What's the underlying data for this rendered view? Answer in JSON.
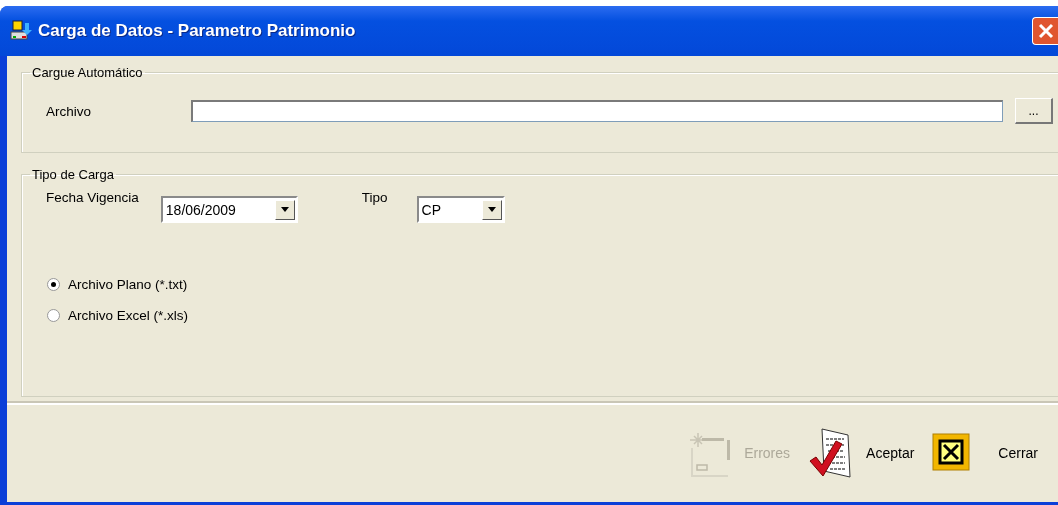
{
  "window": {
    "title": "Carga de Datos - Parametro Patrimonio"
  },
  "auto_load": {
    "legend": "Cargue Automático",
    "file_label": "Archivo",
    "browse_button": "..."
  },
  "load_type": {
    "legend": "Tipo de Carga",
    "date_label": "Fecha Vigencia",
    "date_value": "18/06/2009",
    "type_label": "Tipo",
    "type_value": "CP",
    "options": [
      {
        "label": "Archivo Plano (*.txt)",
        "selected": true
      },
      {
        "label": "Archivo Excel (*.xls)",
        "selected": false
      }
    ]
  },
  "buttons": [
    {
      "kind": "errors",
      "label": "Errores",
      "disabled": true
    },
    {
      "kind": "accept",
      "label": "Aceptar",
      "disabled": false
    },
    {
      "kind": "close",
      "label": "Cerrar",
      "disabled": false
    }
  ]
}
